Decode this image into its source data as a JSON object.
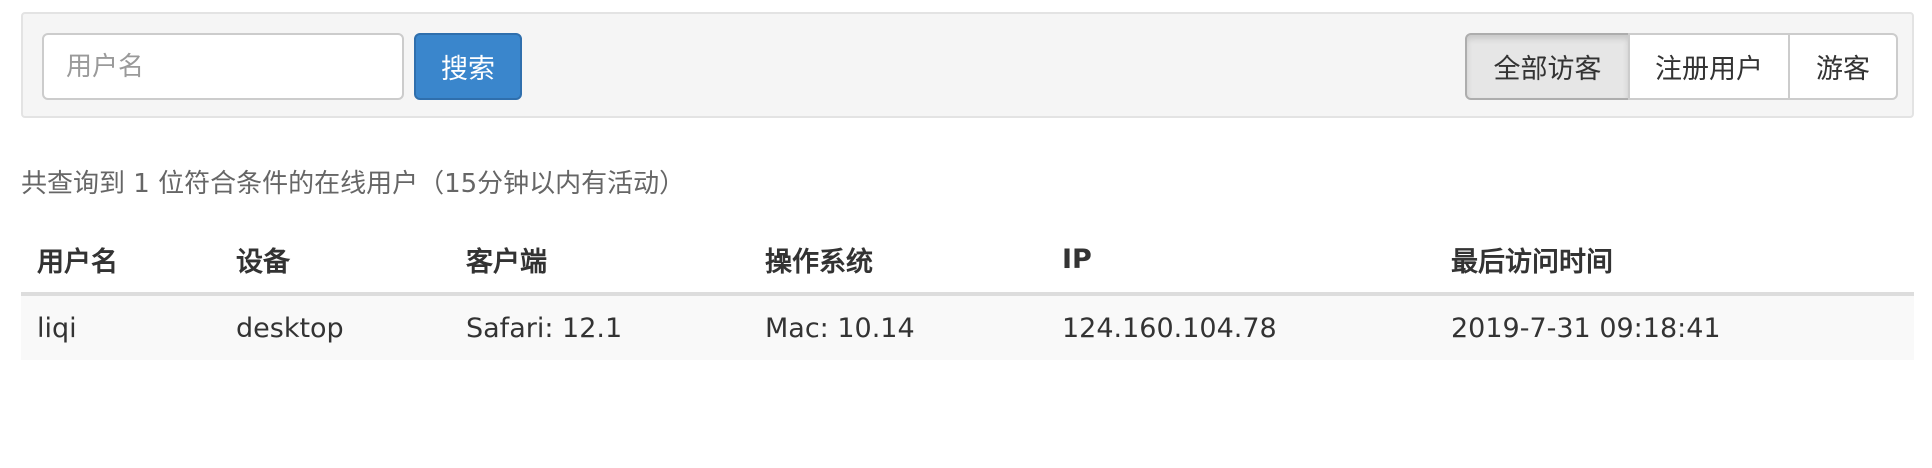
{
  "search": {
    "placeholder": "用户名",
    "button_label": "搜索"
  },
  "filters": [
    {
      "label": "全部访客",
      "active": true
    },
    {
      "label": "注册用户",
      "active": false
    },
    {
      "label": "游客",
      "active": false
    }
  ],
  "summary": "共查询到 1 位符合条件的在线用户（15分钟以内有活动）",
  "table": {
    "headers": [
      "用户名",
      "设备",
      "客户端",
      "操作系统",
      "IP",
      "最后访问时间"
    ],
    "rows": [
      [
        "liqi",
        "desktop",
        "Safari: 12.1",
        "Mac: 10.14",
        "124.160.104.78",
        "2019-7-31 09:18:41"
      ]
    ]
  },
  "colors": {
    "primary_button": "#3a86cc",
    "toolbar_bg": "#f5f5f5",
    "striped_row_bg": "#f9f9f9"
  }
}
